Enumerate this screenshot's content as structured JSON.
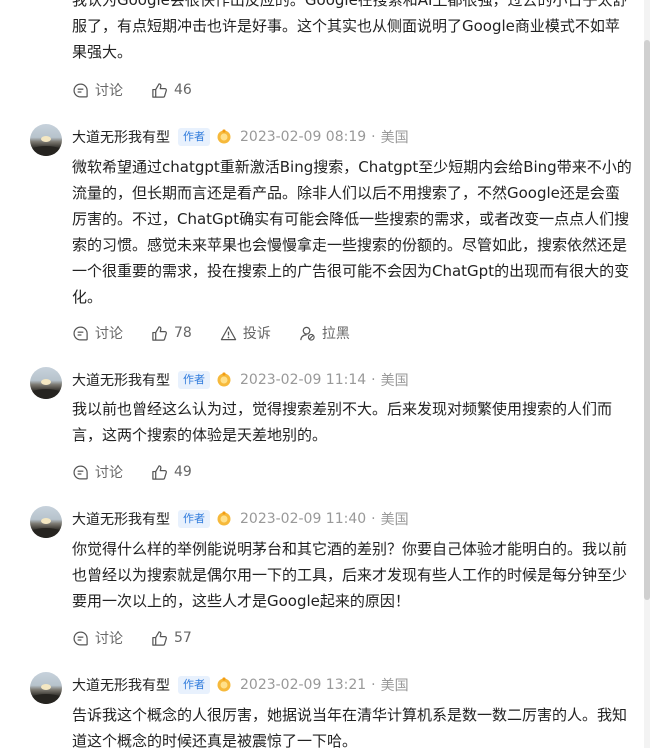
{
  "action_labels": {
    "discuss": "讨论",
    "report": "投诉",
    "block": "拉黑"
  },
  "author_badge": "作者",
  "top_comment": {
    "text": "我认为Google会很快作出反应的。Google在搜索和AI上都很强，过去的小日子太舒服了，有点短期冲击也许是好事。这个其实也从侧面说明了Google商业模式不如苹果强大。",
    "likes": "46"
  },
  "comments": [
    {
      "username": "大道无形我有型",
      "time": "2023-02-09 08:19",
      "location": "美国",
      "text": "微软希望通过chatgpt重新激活Bing搜索，Chatgpt至少短期内会给Bing带来不小的流量的，但长期而言还是看产品。除非人们以后不用搜索了，不然Google还是会蛮厉害的。不过，ChatGpt确实有可能会降低一些搜索的需求，或者改变一点点人们搜索的习惯。感觉未来苹果也会慢慢拿走一些搜索的份额的。尽管如此，搜索依然还是一个很重要的需求，投在搜索上的广告很可能不会因为ChatGpt的出现而有很大的变化。",
      "likes": "78"
    },
    {
      "username": "大道无形我有型",
      "time": "2023-02-09 11:14",
      "location": "美国",
      "text": "我以前也曾经这么认为过，觉得搜索差别不大。后来发现对频繁使用搜索的人们而言，这两个搜索的体验是天差地别的。",
      "likes": "49"
    },
    {
      "username": "大道无形我有型",
      "time": "2023-02-09 11:40",
      "location": "美国",
      "text": "你觉得什么样的举例能说明茅台和其它酒的差别？你要自己体验才能明白的。我以前也曾经以为搜索就是偶尔用一下的工具，后来才发现有些人工作的时候是每分钟至少要用一次以上的，这些人才是Google起来的原因！",
      "likes": "57"
    },
    {
      "username": "大道无形我有型",
      "time": "2023-02-09 13:21",
      "location": "美国",
      "text": "告诉我这个概念的人很厉害，她据说当年在清华计算机系是数一数二厉害的人。我知道这个概念的时候还真是被震惊了一下哈。"
    }
  ]
}
